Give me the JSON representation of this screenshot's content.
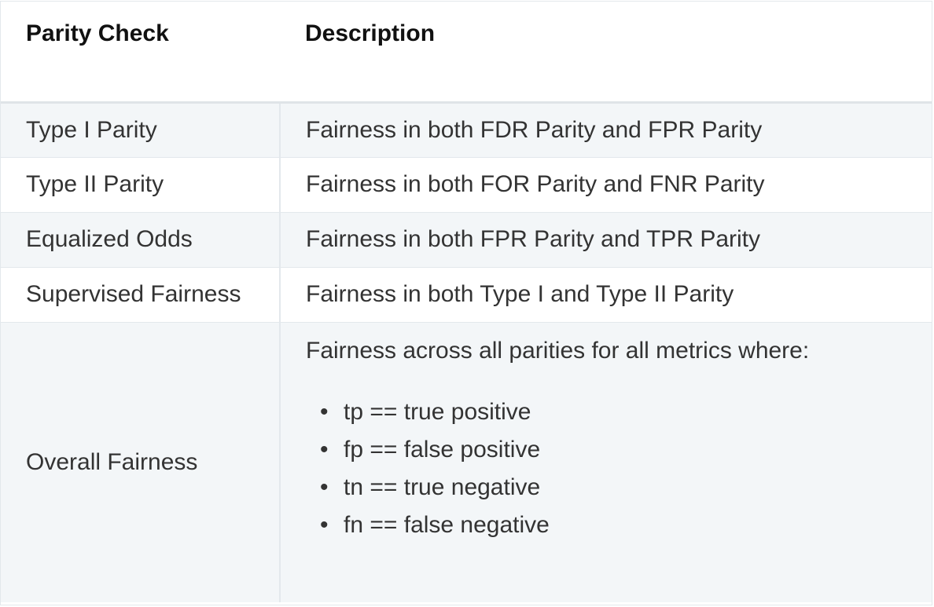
{
  "table": {
    "headers": {
      "check": "Parity Check",
      "description": "Description"
    },
    "rows": [
      {
        "check": "Type I Parity",
        "description": "Fairness in both FDR Parity and FPR Parity"
      },
      {
        "check": "Type II Parity",
        "description": "Fairness in both FOR Parity and FNR Parity"
      },
      {
        "check": "Equalized Odds",
        "description": "Fairness in both FPR Parity and TPR Parity"
      },
      {
        "check": "Supervised Fairness",
        "description": "Fairness in both Type I and Type II Parity"
      }
    ],
    "overall": {
      "check": "Overall Fairness",
      "intro": "Fairness across all parities for all metrics where:",
      "bullet_glyph": "•",
      "items": [
        "tp == true positive",
        "fp == false positive",
        "tn == true negative",
        "fn == false negative"
      ]
    }
  },
  "colors": {
    "stripe": "#f3f6f8",
    "border": "#e3e8ec",
    "text": "#333333",
    "heading": "#111111"
  }
}
